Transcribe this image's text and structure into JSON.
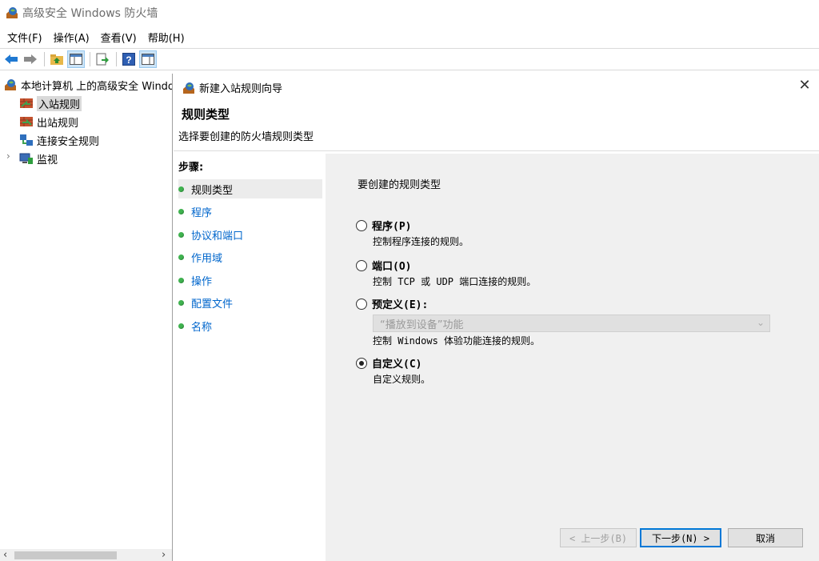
{
  "window": {
    "title": "高级安全 Windows 防火墙"
  },
  "menu": [
    "文件(F)",
    "操作(A)",
    "查看(V)",
    "帮助(H)"
  ],
  "toolbar": {
    "icons": [
      "back-arrow-icon",
      "forward-arrow-icon",
      "up-folder-icon",
      "show-tree-icon",
      "export-list-icon",
      "help-icon",
      "properties-icon"
    ]
  },
  "tree": {
    "root": "本地计算机 上的高级安全 Windows",
    "items": [
      {
        "label": "入站规则",
        "selected": true
      },
      {
        "label": "出站规则"
      },
      {
        "label": "连接安全规则"
      },
      {
        "label": "监视"
      }
    ]
  },
  "wizard": {
    "title": "新建入站规则向导",
    "heading": "规则类型",
    "subtitle": "选择要创建的防火墙规则类型",
    "steps_header": "步骤:",
    "steps": [
      "规则类型",
      "程序",
      "协议和端口",
      "作用域",
      "操作",
      "配置文件",
      "名称"
    ],
    "prompt": "要创建的规则类型",
    "options": [
      {
        "label": "程序(P)",
        "desc": "控制程序连接的规则。",
        "checked": false
      },
      {
        "label": "端口(O)",
        "desc": "控制 TCP 或 UDP 端口连接的规则。",
        "checked": false
      },
      {
        "label": "预定义(E):",
        "combo": "“播放到设备”功能",
        "desc": "控制 Windows 体验功能连接的规则。",
        "checked": false
      },
      {
        "label": "自定义(C)",
        "desc": "自定义规则。",
        "checked": true
      }
    ],
    "buttons": {
      "back": "< 上一步(B)",
      "next": "下一步(N) >",
      "cancel": "取消"
    }
  }
}
